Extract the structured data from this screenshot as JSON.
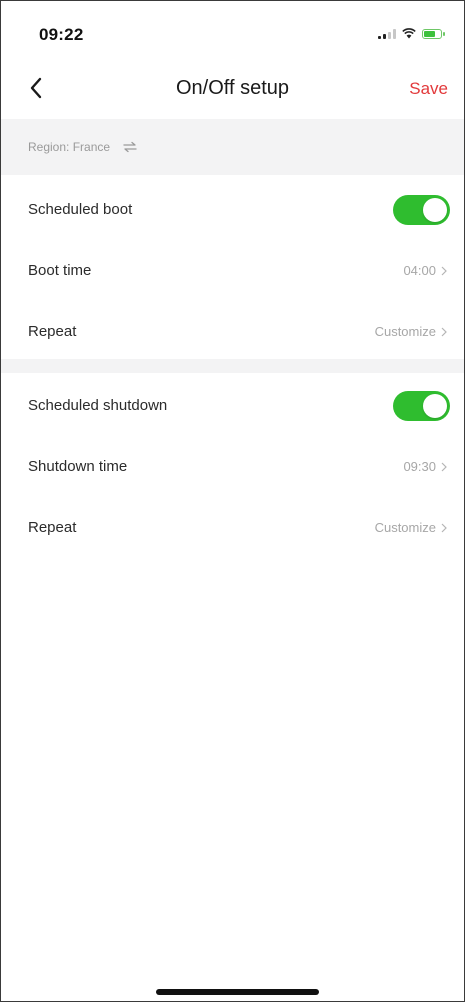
{
  "status_bar": {
    "time": "09:22",
    "icons": [
      "cellular-signal-icon",
      "wifi-icon",
      "battery-icon"
    ],
    "battery_color": "#3dc13c",
    "battery_level": 0.6
  },
  "nav": {
    "title": "On/Off setup",
    "back_icon": "chevron-left-icon",
    "save_label": "Save",
    "save_color": "#e2393b"
  },
  "region": {
    "label": "Region: France",
    "icon": "swap-icon"
  },
  "boot": {
    "toggle_label": "Scheduled boot",
    "toggle_on": true,
    "time_label": "Boot time",
    "time_value": "04:00",
    "repeat_label": "Repeat",
    "repeat_value": "Customize"
  },
  "shutdown": {
    "toggle_label": "Scheduled shutdown",
    "toggle_on": true,
    "time_label": "Shutdown time",
    "time_value": "09:30",
    "repeat_label": "Repeat",
    "repeat_value": "Customize"
  },
  "colors": {
    "toggle_on": "#2fbd2f",
    "accent": "#e2393b",
    "secondary_text": "#a7a7a7"
  }
}
